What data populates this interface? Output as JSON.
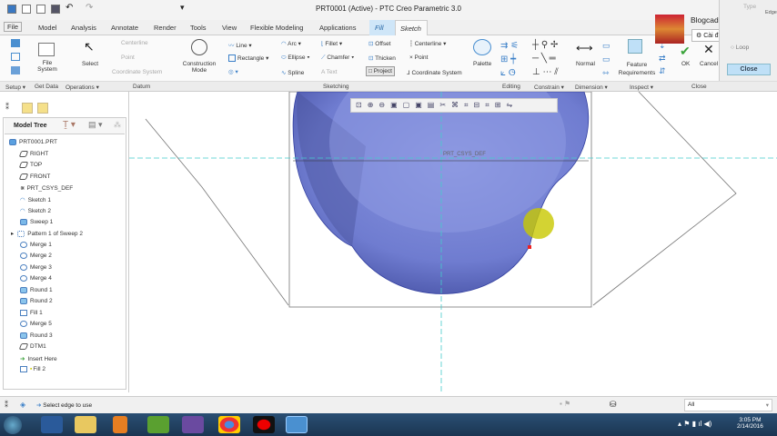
{
  "title": "PRT0001 (Active) - PTC Creo Parametric 3.0",
  "tabs": [
    "File",
    "Model",
    "Analysis",
    "Annotate",
    "Render",
    "Tools",
    "View",
    "Flexible Modeling",
    "Applications",
    "Fill",
    "Sketch"
  ],
  "ribbon": {
    "file_system": "File System",
    "select": "Select",
    "centerline": "Centerline",
    "point": "Point",
    "coordinate_system": "Coordinate System",
    "construction_mode": "Construction Mode",
    "line": "Line",
    "rectangle": "Rectangle",
    "arc": "Arc",
    "ellipse": "Ellipse",
    "spline": "Spline",
    "fillet": "Fillet",
    "chamfer": "Chamfer",
    "text": "Text",
    "offset": "Offset",
    "thicken": "Thicken",
    "project": "Project",
    "centerline2": "Centerline",
    "point2": "Point",
    "coordinate_system2": "Coordinate System",
    "palette": "Palette",
    "normal": "Normal",
    "feature_requirements": "Feature Requirements",
    "ok": "OK",
    "cancel": "Cancel"
  },
  "groups": [
    "Setup",
    "Get Data",
    "Operations",
    "Datum",
    "Sketching",
    "Editing",
    "Constrain",
    "Dimension",
    "Inspect",
    "Close"
  ],
  "channel": {
    "name": "Blogcadcam",
    "settings": "Cài đặt kênh"
  },
  "side_dialog": {
    "type": "Type",
    "edge": "Edge",
    "loop": "Loop",
    "close": "Close"
  },
  "model_tree": {
    "label": "Model Tree",
    "items": [
      "PRT0001.PRT",
      "RIGHT",
      "TOP",
      "FRONT",
      "PRT_CSYS_DEF",
      "Sketch 1",
      "Sketch 2",
      "Sweep 1",
      "Pattern 1 of Sweep 2",
      "Merge 1",
      "Merge 2",
      "Merge 3",
      "Merge 4",
      "Round 1",
      "Round 2",
      "Fill 1",
      "Merge 5",
      "Round 3",
      "DTM1",
      "Insert Here",
      "Fill 2"
    ]
  },
  "graphics": {
    "csys_label": "PRT_CSYS_DEF"
  },
  "status": {
    "message": "Select edge to use",
    "filter": "All"
  },
  "taskbar": {
    "time": "3:05 PM",
    "date": "2/14/2016"
  }
}
